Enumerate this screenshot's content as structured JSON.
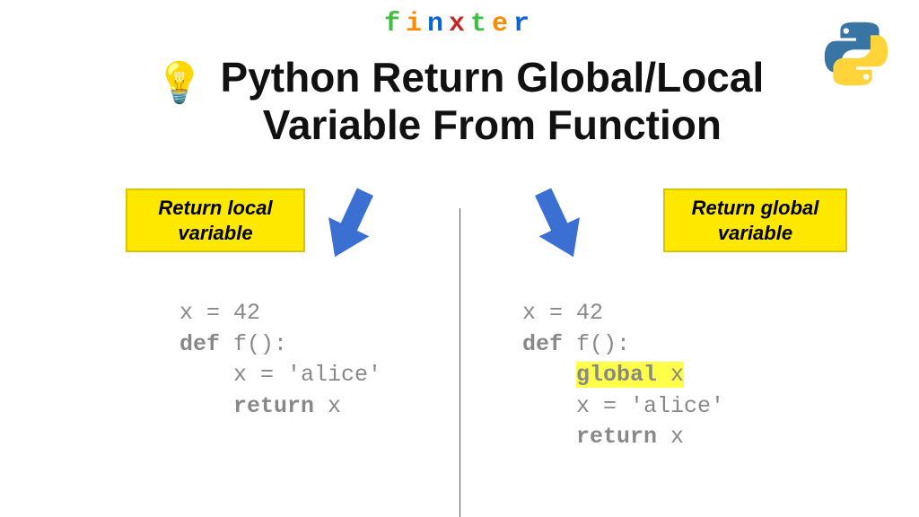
{
  "brand": {
    "letters": [
      "f",
      "i",
      "n",
      "x",
      "t",
      "e",
      "r"
    ],
    "colors": [
      "#3fbf3f",
      "#ff8a00",
      "#0b63d6",
      "#c62828",
      "#3fbf3f",
      "#ff8a00",
      "#0b63d6"
    ]
  },
  "title_line1": "Python Return Global/Local",
  "title_line2": "Variable From Function",
  "left": {
    "callout_line1": "Return local",
    "callout_line2": "variable",
    "code_l1_a": "x = 42",
    "code_l2_kw": "def",
    "code_l2_b": " f():",
    "code_l3": "    x = 'alice'",
    "code_l4_pad": "    ",
    "code_l4_kw": "return",
    "code_l4_b": " x"
  },
  "right": {
    "callout_line1": "Return global",
    "callout_line2": "variable",
    "code_l1_a": "x = 42",
    "code_l2_kw": "def",
    "code_l2_b": " f():",
    "code_l3_pad": "    ",
    "code_l3_kw": "global",
    "code_l3_b": " x",
    "code_l4": "    x = 'alice'",
    "code_l5_pad": "    ",
    "code_l5_kw": "return",
    "code_l5_b": " x"
  },
  "arrow_color": "#3b6fd1"
}
